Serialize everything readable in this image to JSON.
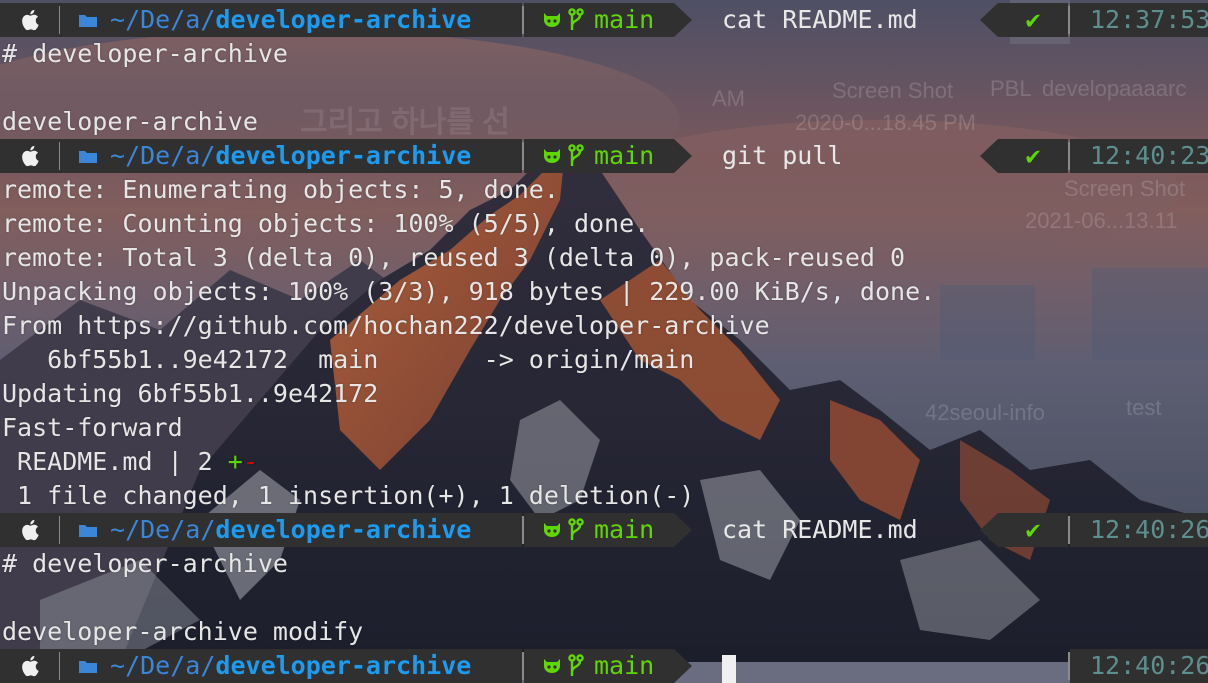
{
  "colors": {
    "segment_bg": "#303030",
    "dir_blue": "#3a86d8",
    "dir_bold_blue": "#1d9bf0",
    "git_green": "#5fd700",
    "time_teal": "#5e8f8f",
    "deletion_red": "#d70000",
    "text": "#e6e6e6"
  },
  "background_ghosts": {
    "screenshot_a_title": "Screen Shot",
    "screenshot_a_date": "2020-0...18.45 PM",
    "pbl_label": "PBL",
    "developaaaarc": "developaaaarc",
    "am_label": "AM",
    "screenshot_b_title": "Screen Shot",
    "screenshot_b_date": "2021-06...13.11",
    "seoul_info": "42seoul-info",
    "test_label": "test",
    "korean_text": "그리고 하나를 선"
  },
  "prompts": [
    {
      "os_icon": "apple-icon",
      "dir_icon": "folder-icon",
      "dir_home": "~",
      "dir_sep": "/",
      "dir_parts": [
        "De",
        "a"
      ],
      "dir_last": "developer-archive",
      "git_icon": "github-cat-icon",
      "branch_icon": "git-branch-icon",
      "branch": "main",
      "command": "cat README.md",
      "status": "✔",
      "time": "12:37:53"
    },
    {
      "os_icon": "apple-icon",
      "dir_icon": "folder-icon",
      "dir_home": "~",
      "dir_sep": "/",
      "dir_parts": [
        "De",
        "a"
      ],
      "dir_last": "developer-archive",
      "git_icon": "github-cat-icon",
      "branch_icon": "git-branch-icon",
      "branch": "main",
      "command": "git pull",
      "status": "✔",
      "time": "12:40:23"
    },
    {
      "os_icon": "apple-icon",
      "dir_icon": "folder-icon",
      "dir_home": "~",
      "dir_sep": "/",
      "dir_parts": [
        "De",
        "a"
      ],
      "dir_last": "developer-archive",
      "git_icon": "github-cat-icon",
      "branch_icon": "git-branch-icon",
      "branch": "main",
      "command": "cat README.md",
      "status": "✔",
      "time": "12:40:26"
    },
    {
      "os_icon": "apple-icon",
      "dir_icon": "folder-icon",
      "dir_home": "~",
      "dir_sep": "/",
      "dir_parts": [
        "De",
        "a"
      ],
      "dir_last": "developer-archive",
      "git_icon": "github-cat-icon",
      "branch_icon": "git-branch-icon",
      "branch": "main",
      "command": "",
      "status": "",
      "time": "12:40:26"
    }
  ],
  "output_1": [
    "# developer-archive",
    "",
    "developer-archive"
  ],
  "output_2": [
    "remote: Enumerating objects: 5, done.",
    "remote: Counting objects: 100% (5/5), done.",
    "remote: Total 3 (delta 0), reused 3 (delta 0), pack-reused 0",
    "Unpacking objects: 100% (3/3), 918 bytes | 229.00 KiB/s, done.",
    "From https://github.com/hochan222/developer-archive",
    "   6bf55b1..9e42172  main       -> origin/main",
    "Updating 6bf55b1..9e42172",
    "Fast-forward"
  ],
  "diffstat": {
    "file_prefix": " README.md | 2 ",
    "plus": "+",
    "minus": "-"
  },
  "summary_line": " 1 file changed, 1 insertion(+), 1 deletion(-)",
  "output_3": [
    "# developer-archive",
    "",
    "developer-archive modify"
  ]
}
